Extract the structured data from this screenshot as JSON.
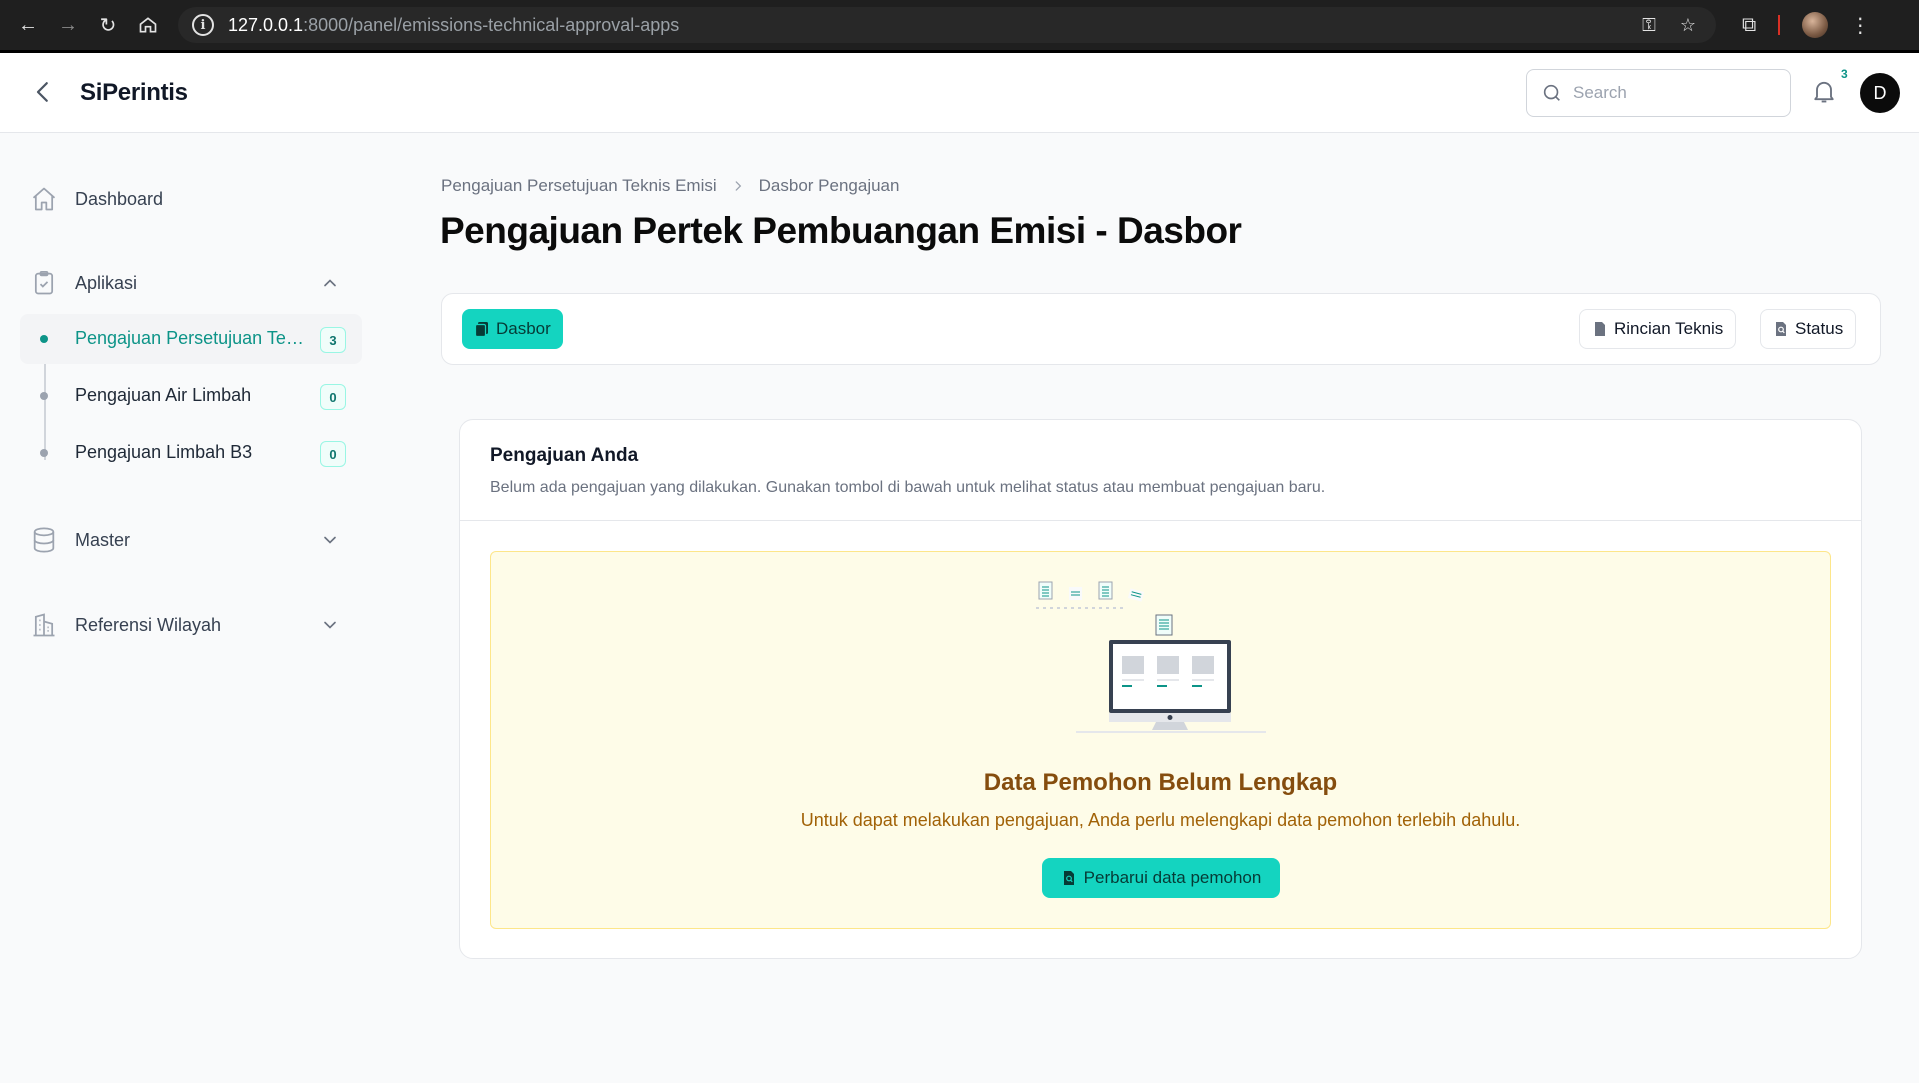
{
  "browser": {
    "url_host": "127.0.0.1",
    "url_path": ":8000/panel/emissions-technical-approval-apps"
  },
  "app": {
    "brand": "SiPerintis",
    "search_placeholder": "Search",
    "notification_count": "3",
    "avatar_initial": "D"
  },
  "sidebar": {
    "dashboard": "Dashboard",
    "aplikasi": "Aplikasi",
    "sub_items": [
      {
        "label": "Pengajuan Persetujuan Teknis Emisi",
        "count": "3"
      },
      {
        "label": "Pengajuan Air Limbah",
        "count": "0"
      },
      {
        "label": "Pengajuan Limbah B3",
        "count": "0"
      }
    ],
    "master": "Master",
    "referensi": "Referensi Wilayah"
  },
  "breadcrumb": {
    "first": "Pengajuan Persetujuan Teknis Emisi",
    "second": "Dasbor Pengajuan"
  },
  "page_title": "Pengajuan Pertek Pembuangan Emisi - Dasbor",
  "tabs": {
    "dasbor": "Dasbor",
    "rincian": "Rincian Teknis",
    "status": "Status"
  },
  "card": {
    "title": "Pengajuan Anda",
    "description": "Belum ada pengajuan yang dilakukan. Gunakan tombol di bawah untuk melihat status atau membuat pengajuan baru."
  },
  "notice": {
    "title": "Data Pemohon Belum Lengkap",
    "description": "Untuk dapat melakukan pengajuan, Anda perlu melengkapi data pemohon terlebih dahulu.",
    "button": "Perbarui data pemohon"
  },
  "colors": {
    "accent": "#14d4c0",
    "accent_text": "#0d9488",
    "notice_bg": "#fefce8",
    "notice_title": "#854d0e"
  }
}
